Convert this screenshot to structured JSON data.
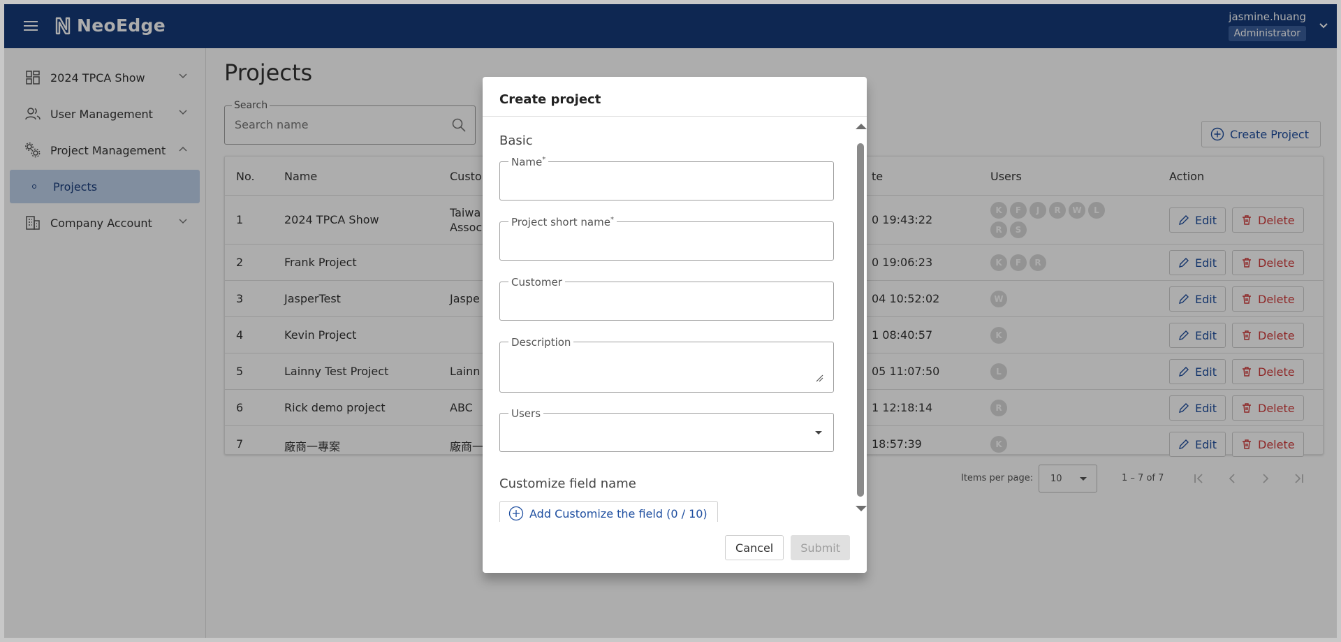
{
  "header": {
    "brand": "NeoEdge",
    "user_name": "jasmine.huang",
    "user_role": "Administrator",
    "bg_color": "#153a7a"
  },
  "sidebar": {
    "items": [
      {
        "label": "2024 TPCA Show",
        "icon": "dashboard-icon",
        "expanded": false
      },
      {
        "label": "User Management",
        "icon": "users-icon",
        "expanded": false
      },
      {
        "label": "Project Management",
        "icon": "gears-icon",
        "expanded": true
      },
      {
        "label": "Company Account",
        "icon": "building-icon",
        "expanded": false
      }
    ],
    "sub_items": [
      {
        "label": "Projects",
        "selected": true
      }
    ]
  },
  "main": {
    "title": "Projects",
    "search": {
      "label": "Search",
      "placeholder": "Search name",
      "value": ""
    },
    "create_button": "Create Project",
    "table": {
      "columns": [
        "No.",
        "Name",
        "Custo",
        "te",
        "Users",
        "Action"
      ],
      "rows": [
        {
          "no": "1",
          "name": "2024 TPCA Show",
          "customer_line1": "Taiwa",
          "customer_line2": "Assoc",
          "date": "0 19:43:22",
          "users": [
            "K",
            "F",
            "J",
            "R",
            "W",
            "L",
            "R",
            "S"
          ]
        },
        {
          "no": "2",
          "name": "Frank Project",
          "customer_line1": "",
          "customer_line2": "",
          "date": "0 19:06:23",
          "users": [
            "K",
            "F",
            "R"
          ]
        },
        {
          "no": "3",
          "name": "JasperTest",
          "customer_line1": "Jaspe",
          "customer_line2": "",
          "date": "04 10:52:02",
          "users": [
            "W"
          ]
        },
        {
          "no": "4",
          "name": "Kevin Project",
          "customer_line1": "",
          "customer_line2": "",
          "date": "1 08:40:57",
          "users": [
            "K"
          ]
        },
        {
          "no": "5",
          "name": "Lainny Test Project",
          "customer_line1": "Lainn",
          "customer_line2": "",
          "date": "05 11:07:50",
          "users": [
            "L"
          ]
        },
        {
          "no": "6",
          "name": "Rick demo project",
          "customer_line1": "ABC",
          "customer_line2": "",
          "date": "1 12:18:14",
          "users": [
            "R"
          ]
        },
        {
          "no": "7",
          "name": "廠商一專案",
          "customer_line1": "廠商一",
          "customer_line2": "",
          "date": "18:57:39",
          "users": [
            "K"
          ]
        }
      ],
      "edit_label": "Edit",
      "delete_label": "Delete"
    },
    "pagination": {
      "items_per_page_label": "Items per page:",
      "items_per_page": "10",
      "range": "1 – 7 of 7"
    }
  },
  "dialog": {
    "title": "Create project",
    "section_basic": "Basic",
    "fields": {
      "name": {
        "label": "Name",
        "required_mark": "*",
        "value": ""
      },
      "short_name": {
        "label": "Project short name",
        "required_mark": "*",
        "value": ""
      },
      "customer": {
        "label": "Customer",
        "value": ""
      },
      "description": {
        "label": "Description",
        "value": ""
      },
      "users": {
        "label": "Users",
        "value": ""
      }
    },
    "section_customize": "Customize field name",
    "add_field_button": "Add Customize the field (0 / 10)",
    "cancel_label": "Cancel",
    "submit_label": "Submit"
  }
}
